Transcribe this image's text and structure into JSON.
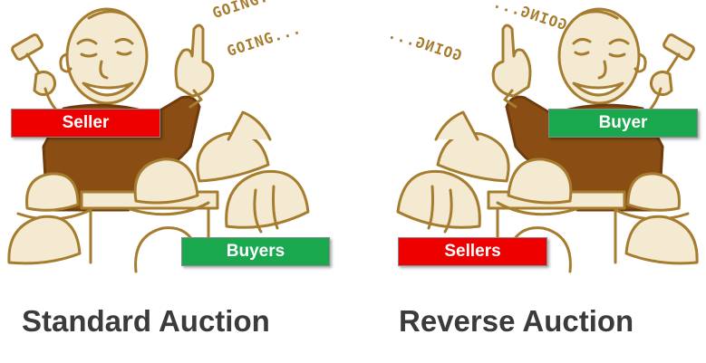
{
  "colors": {
    "illustration": "#a67c2e",
    "red_label": "#ef0000",
    "green_label": "#1aa84e",
    "caption": "#3b3b3b"
  },
  "standard": {
    "going_1": "GOING...",
    "going_2": "GOING...",
    "seller_label": "Seller",
    "buyers_label": "Buyers",
    "caption": "Standard Auction"
  },
  "reverse": {
    "going_1": "GOING...",
    "going_2": "GOING...",
    "buyer_label": "Buyer",
    "sellers_label": "Sellers",
    "caption": "Reverse Auction"
  }
}
